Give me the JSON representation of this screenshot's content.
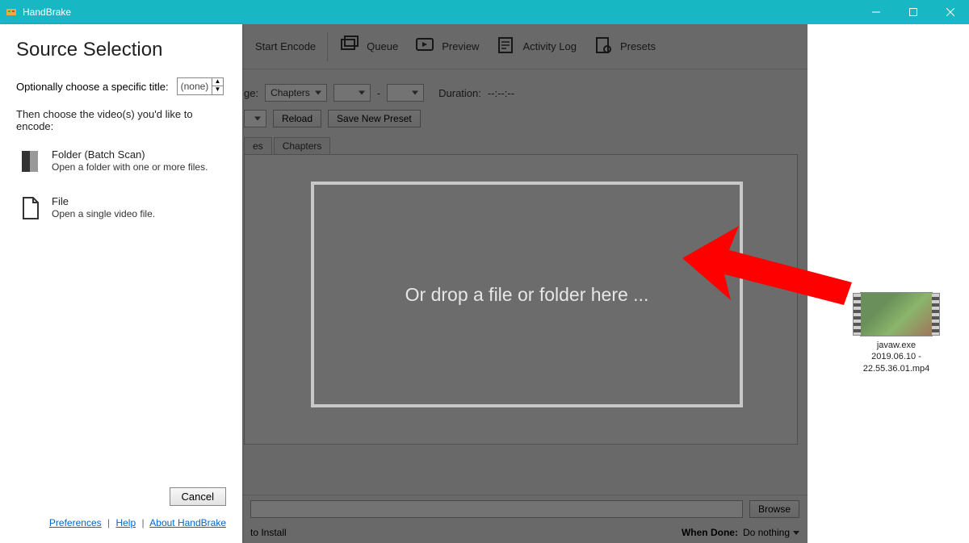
{
  "window": {
    "title": "HandBrake"
  },
  "toolbar": {
    "start": "Start Encode",
    "queue": "Queue",
    "preview": "Preview",
    "log": "Activity Log",
    "presets": "Presets"
  },
  "main": {
    "range_label_suffix": "ge:",
    "range_select": "Chapters",
    "range_dash": "-",
    "duration_label": "Duration:",
    "duration_value": "--:--:--",
    "reload": "Reload",
    "save_preset": "Save New Preset",
    "tabs": {
      "a": "es",
      "b": "Chapters"
    },
    "browse": "Browse",
    "status_left": "to Install",
    "when_done": "When Done:",
    "when_done_value": "Do nothing"
  },
  "drop": {
    "text": "Or drop a file or folder here ..."
  },
  "src": {
    "heading": "Source Selection",
    "title_label": "Optionally choose a specific title:",
    "title_value": "(none)",
    "hint": "Then choose the video(s) you'd like to encode:",
    "folder": {
      "t1": "Folder (Batch Scan)",
      "t2": "Open a folder with one or more files."
    },
    "file": {
      "t1": "File",
      "t2": "Open a single video file."
    },
    "cancel": "Cancel",
    "links": {
      "prefs": "Preferences",
      "help": "Help",
      "about": "About HandBrake"
    }
  },
  "desktop": {
    "filename_l1": "javaw.exe",
    "filename_l2": "2019.06.10 -",
    "filename_l3": "22.55.36.01.mp4"
  }
}
